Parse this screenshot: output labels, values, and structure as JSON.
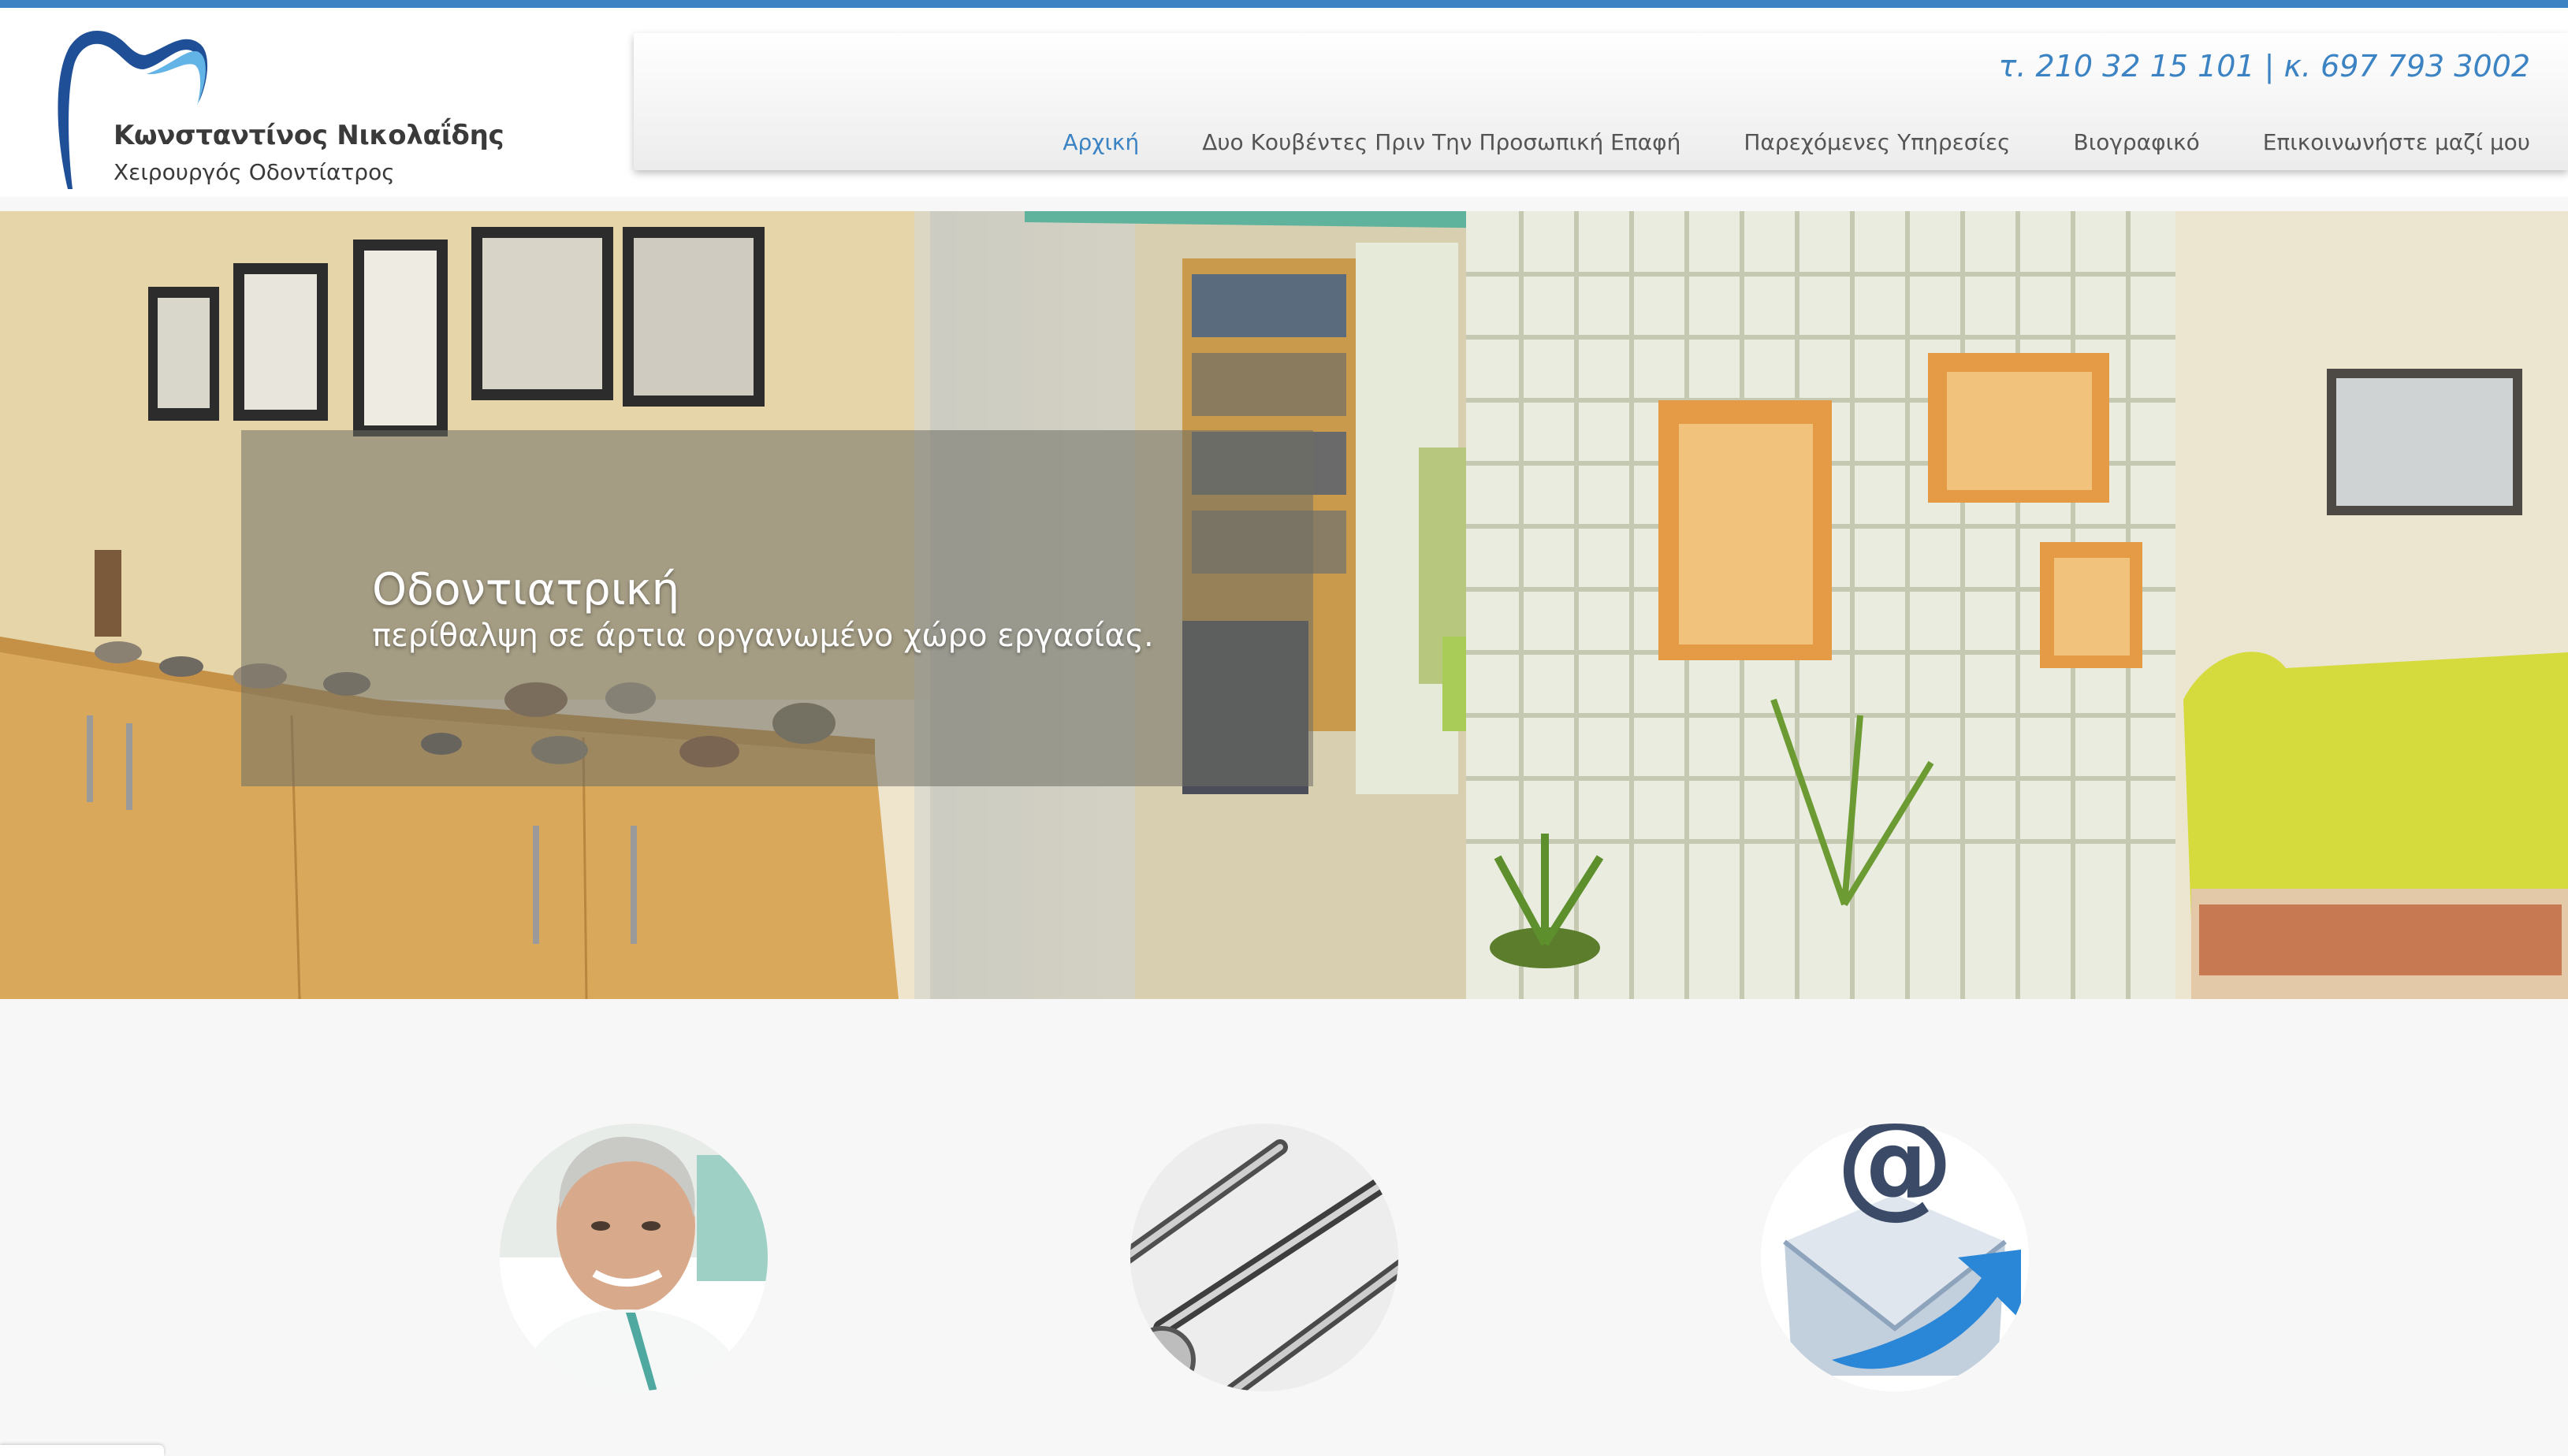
{
  "header": {
    "logo": {
      "name": "Κωνσταντίνος Νικολαΐδης",
      "subtitle": "Χειρουργός Οδοντίατρος",
      "icon": "tooth-logo-icon"
    },
    "contact": "τ. 210 32 15 101 | κ. 697 793 3002",
    "nav": [
      {
        "label": "Αρχική",
        "active": true
      },
      {
        "label": "Δυο Κουβέντες Πριν Την Προσωπική Επαφή",
        "active": false
      },
      {
        "label": "Παρεχόμενες Υπηρεσίες",
        "active": false
      },
      {
        "label": "Βιογραφικό",
        "active": false
      },
      {
        "label": "Επικοινωνήστε μαζί μου",
        "active": false
      }
    ]
  },
  "hero": {
    "title": "Οδοντιατρική",
    "subtitle": "περίθαλψη σε άρτια οργανωμένο χώρο εργασίας."
  },
  "features": [
    {
      "icon": "doctor-portrait-image"
    },
    {
      "icon": "dental-instruments-image"
    },
    {
      "icon": "email-envelope-icon"
    }
  ],
  "colors": {
    "accent": "#3b83c3",
    "nav_text": "#555555",
    "page_bg": "#f7f7f7"
  }
}
